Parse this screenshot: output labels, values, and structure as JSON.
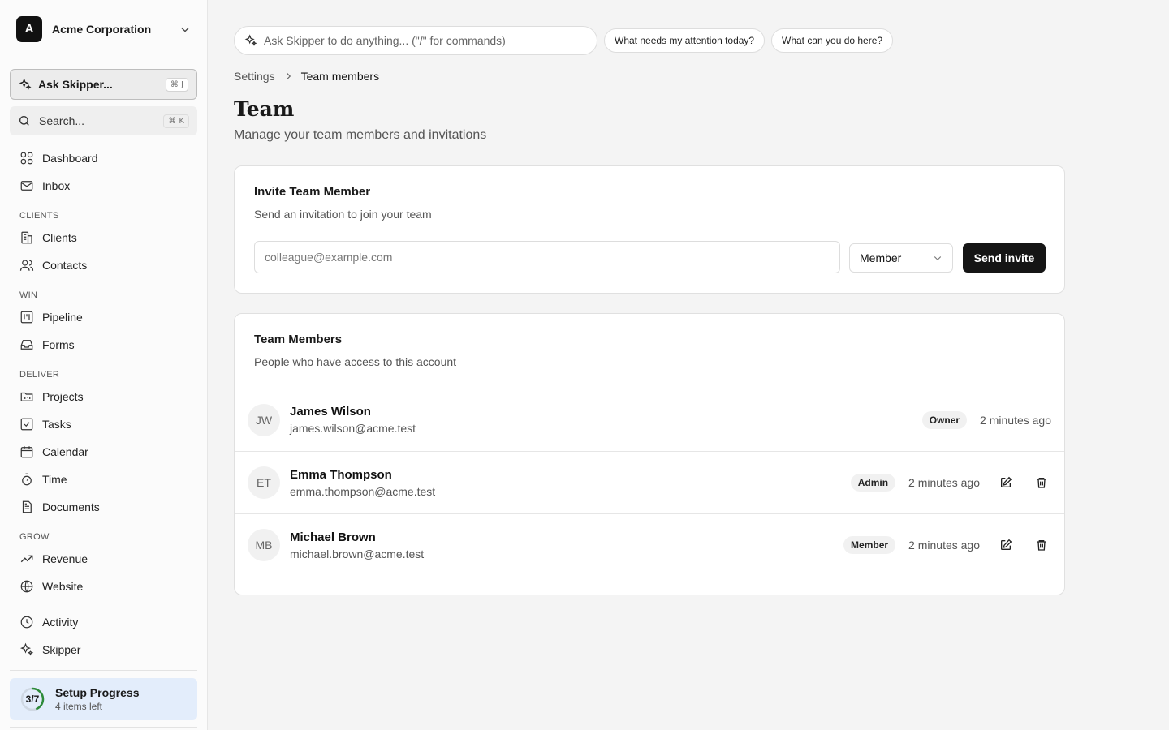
{
  "org": {
    "initial": "A",
    "name": "Acme Corporation"
  },
  "sidebar": {
    "ask": {
      "label": "Ask Skipper...",
      "shortcut": "⌘ J"
    },
    "search": {
      "label": "Search...",
      "shortcut": "⌘ K"
    },
    "top_items": [
      {
        "label": "Dashboard",
        "icon": "grid-icon"
      },
      {
        "label": "Inbox",
        "icon": "mail-icon"
      }
    ],
    "sections": [
      {
        "title": "CLIENTS",
        "items": [
          {
            "label": "Clients",
            "icon": "building-icon"
          },
          {
            "label": "Contacts",
            "icon": "users-icon"
          }
        ]
      },
      {
        "title": "WIN",
        "items": [
          {
            "label": "Pipeline",
            "icon": "kanban-icon"
          },
          {
            "label": "Forms",
            "icon": "inbox-tray-icon"
          }
        ]
      },
      {
        "title": "DELIVER",
        "items": [
          {
            "label": "Projects",
            "icon": "folder-icon"
          },
          {
            "label": "Tasks",
            "icon": "checkbox-icon"
          },
          {
            "label": "Calendar",
            "icon": "calendar-icon"
          },
          {
            "label": "Time",
            "icon": "stopwatch-icon"
          },
          {
            "label": "Documents",
            "icon": "document-icon"
          }
        ]
      },
      {
        "title": "GROW",
        "items": [
          {
            "label": "Revenue",
            "icon": "trending-up-icon"
          },
          {
            "label": "Website",
            "icon": "globe-icon"
          }
        ]
      }
    ],
    "bottom_items": [
      {
        "label": "Activity",
        "icon": "clock-icon"
      },
      {
        "label": "Skipper",
        "icon": "sparkles-icon"
      }
    ],
    "setup": {
      "progress": "3/7",
      "progress_fraction": 0.4286,
      "title": "Setup Progress",
      "subtitle": "4 items left"
    }
  },
  "topbar": {
    "command_placeholder": "Ask Skipper to do anything... (\"/\" for commands)",
    "chips": [
      "What needs my attention today?",
      "What can you do here?"
    ]
  },
  "breadcrumb": {
    "parent": "Settings",
    "current": "Team members"
  },
  "page": {
    "title": "Team",
    "subtitle": "Manage your team members and invitations"
  },
  "invite": {
    "title": "Invite Team Member",
    "subtitle": "Send an invitation to join your team",
    "email_placeholder": "colleague@example.com",
    "role_value": "Member",
    "send_label": "Send invite"
  },
  "members_card": {
    "title": "Team Members",
    "subtitle": "People who have access to this account",
    "members": [
      {
        "initials": "JW",
        "name": "James Wilson",
        "email": "james.wilson@acme.test",
        "role": "Owner",
        "time": "2 minutes ago",
        "editable": false
      },
      {
        "initials": "ET",
        "name": "Emma Thompson",
        "email": "emma.thompson@acme.test",
        "role": "Admin",
        "time": "2 minutes ago",
        "editable": true
      },
      {
        "initials": "MB",
        "name": "Michael Brown",
        "email": "michael.brown@acme.test",
        "role": "Member",
        "time": "2 minutes ago",
        "editable": true
      }
    ]
  },
  "colors": {
    "accent_dark": "#151515",
    "setup_bg": "#e3edfb",
    "progress_ring": "#2e8b3a"
  }
}
